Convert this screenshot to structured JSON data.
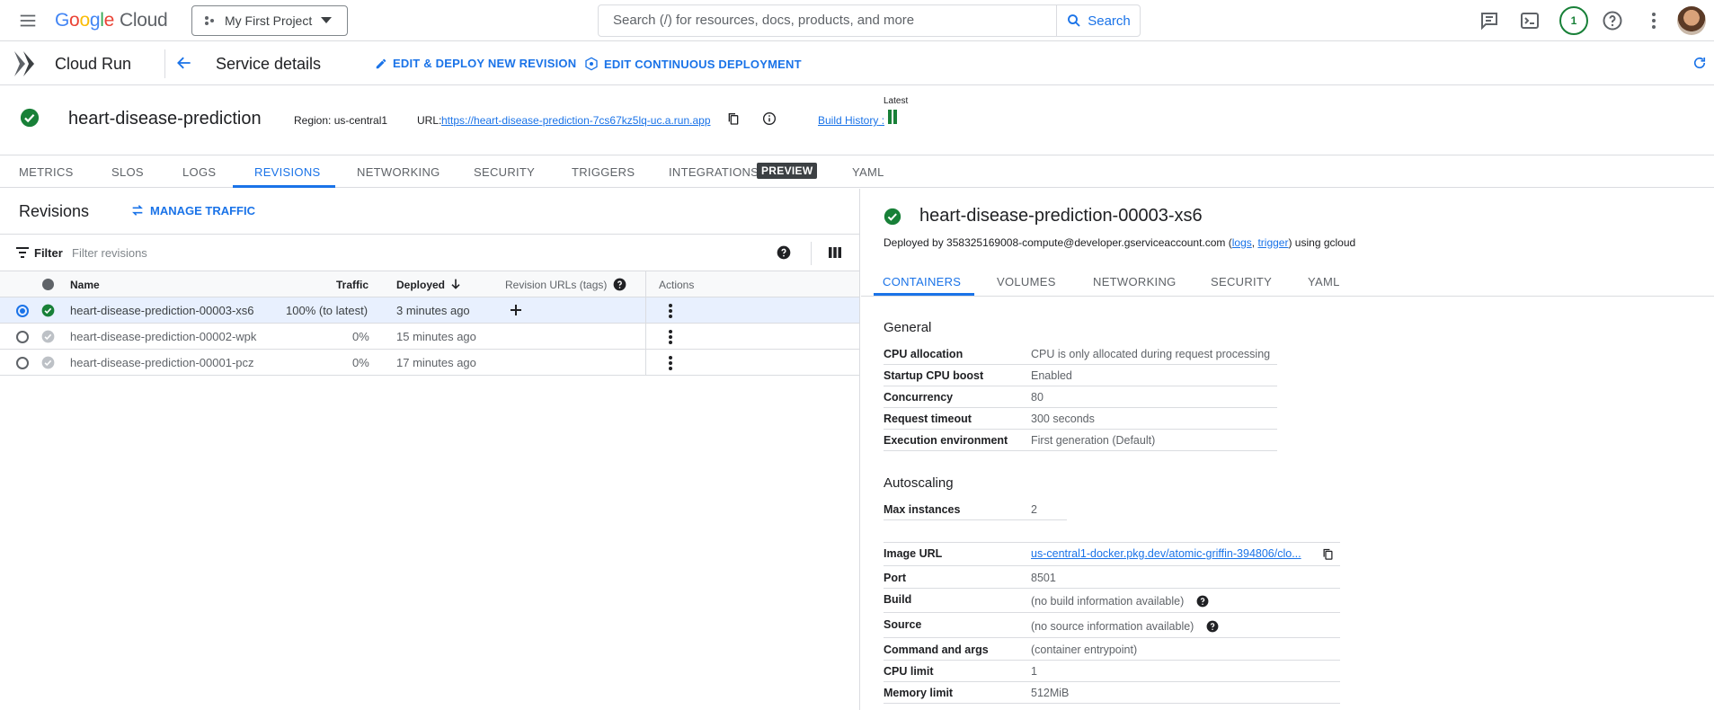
{
  "topbar": {
    "product_prefix": "Google",
    "product_suffix": "Cloud",
    "project": "My First Project",
    "search_placeholder": "Search (/) for resources, docs, products, and more",
    "search_button": "Search",
    "notifications_count": "1",
    "icons": [
      "menu-icon",
      "feedback-icon",
      "cloud-shell-icon",
      "help-icon",
      "more-vert-icon"
    ]
  },
  "service_bar": {
    "app_name": "Cloud Run",
    "page_title": "Service details",
    "edit_deploy_label": "EDIT & DEPLOY NEW REVISION",
    "edit_cd_label": "EDIT CONTINUOUS DEPLOYMENT"
  },
  "service": {
    "name": "heart-disease-prediction",
    "region": "Region: us-central1",
    "url_label": "URL:",
    "url": "https://heart-disease-prediction-7cs67kz5lq-uc.a.run.app",
    "build_history": "Build History",
    "latest": "Latest"
  },
  "tabs": {
    "metrics": "METRICS",
    "slos": "SLOS",
    "logs": "LOGS",
    "revisions": "REVISIONS",
    "networking": "NETWORKING",
    "security": "SECURITY",
    "triggers": "TRIGGERS",
    "integrations": "INTEGRATIONS",
    "preview": "PREVIEW",
    "yaml": "YAML"
  },
  "revisions": {
    "title": "Revisions",
    "manage_traffic": "MANAGE TRAFFIC",
    "filter_label": "Filter",
    "filter_placeholder": "Filter revisions",
    "columns": {
      "name": "Name",
      "traffic": "Traffic",
      "deployed": "Deployed",
      "urls": "Revision URLs (tags)",
      "actions": "Actions"
    },
    "rows": [
      {
        "name": "heart-disease-prediction-00003-xs6",
        "traffic": "100% (to latest)",
        "deployed": "3 minutes ago",
        "selected": true
      },
      {
        "name": "heart-disease-prediction-00002-wpk",
        "traffic": "0%",
        "deployed": "15 minutes ago",
        "selected": false
      },
      {
        "name": "heart-disease-prediction-00001-pcz",
        "traffic": "0%",
        "deployed": "17 minutes ago",
        "selected": false
      }
    ]
  },
  "detail": {
    "title": "heart-disease-prediction-00003-xs6",
    "deployed_by_prefix": "Deployed by 358325169008-compute@developer.gserviceaccount.com (",
    "logs_link": "logs",
    "comma": ", ",
    "trigger_link": "trigger",
    "deployed_by_suffix": ") using gcloud",
    "tabs": {
      "containers": "CONTAINERS",
      "volumes": "VOLUMES",
      "networking": "NETWORKING",
      "security": "SECURITY",
      "yaml": "YAML"
    },
    "general_title": "General",
    "general": [
      {
        "k": "CPU allocation",
        "v": "CPU is only allocated during request processing"
      },
      {
        "k": "Startup CPU boost",
        "v": "Enabled"
      },
      {
        "k": "Concurrency",
        "v": "80"
      },
      {
        "k": "Request timeout",
        "v": "300 seconds"
      },
      {
        "k": "Execution environment",
        "v": "First generation (Default)"
      }
    ],
    "autoscaling_title": "Autoscaling",
    "autoscaling": [
      {
        "k": "Max instances",
        "v": "2"
      }
    ],
    "container": [
      {
        "k": "Image URL",
        "v": "us-central1-docker.pkg.dev/atomic-griffin-394806/clo..."
      },
      {
        "k": "Port",
        "v": "8501"
      },
      {
        "k": "Build",
        "v": "(no build information available)"
      },
      {
        "k": "Source",
        "v": "(no source information available)"
      },
      {
        "k": "Command and args",
        "v": "(container entrypoint)"
      },
      {
        "k": "CPU limit",
        "v": "1"
      },
      {
        "k": "Memory limit",
        "v": "512MiB"
      }
    ]
  },
  "colors": {
    "accent": "#1a73e8",
    "success": "#188038",
    "border": "#dadce0"
  }
}
